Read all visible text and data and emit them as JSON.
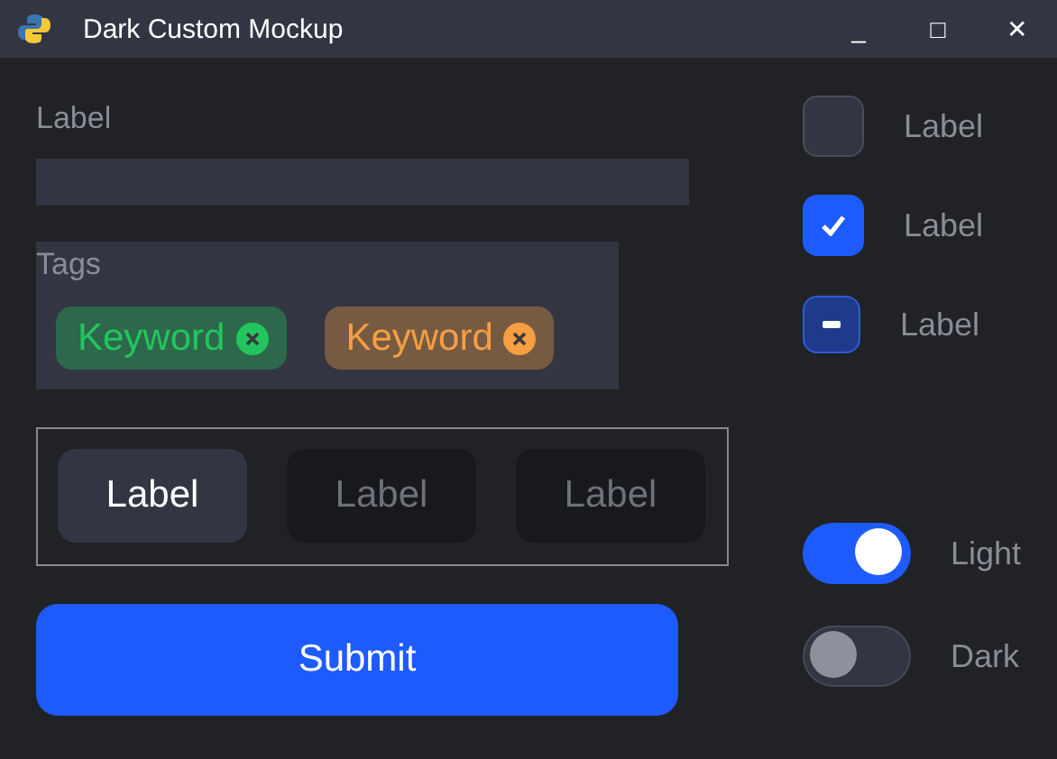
{
  "window": {
    "title": "Dark Custom Mockup",
    "controls": [
      "_",
      "□",
      "✕"
    ]
  },
  "field": {
    "label": "Label"
  },
  "tags": {
    "label": "Tags",
    "items": [
      {
        "text": "Keyword",
        "color": "#22c55e"
      },
      {
        "text": "Keyword",
        "color": "#f59e42"
      }
    ]
  },
  "segments": [
    {
      "label": "Label",
      "selected": true
    },
    {
      "label": "Label",
      "selected": false
    },
    {
      "label": "Label",
      "selected": false
    }
  ],
  "submit": "Submit",
  "checkboxes": [
    {
      "label": "Label",
      "checked": false,
      "indeterminate": false
    },
    {
      "label": "Label",
      "checked": true,
      "indeterminate": false
    },
    {
      "label": "Label",
      "checked": false,
      "indeterminate": true
    }
  ],
  "toggles": [
    {
      "label": "Light",
      "on": true
    },
    {
      "label": "Dark",
      "on": false
    }
  ]
}
